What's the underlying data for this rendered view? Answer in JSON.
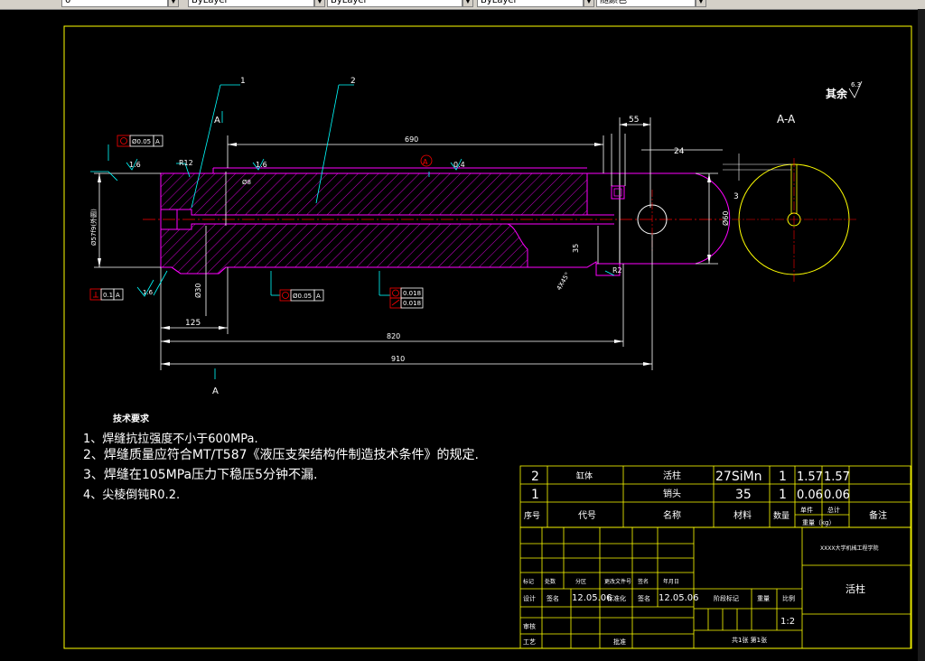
{
  "toolbar": {
    "layer_value": "0",
    "color_value": "ByLayer",
    "linetype_value": "ByLayer",
    "lineweight_value": "ByLayer",
    "plotstyle_value": "随颜色"
  },
  "drawing": {
    "section_title": "A-A",
    "roughness_other": "其余",
    "roughness_other_value": "6.3",
    "part_labels": [
      "1",
      "2"
    ],
    "section_marks": [
      "A",
      "A"
    ],
    "dims": {
      "d690": "690",
      "d55": "55",
      "d24": "24",
      "d125": "125",
      "d910": "910",
      "d_inner": "820",
      "d35": "35",
      "d30": "Ø30",
      "d3": "3",
      "d60": "Ø60",
      "r12": "R12",
      "r2": "R2",
      "d45": "4X45°",
      "phi57": "Ø57f9(外圆)",
      "phi8": "Ø8"
    },
    "roughness": [
      "1.6",
      "1.6",
      "0.4",
      "1.6"
    ],
    "tolerances": {
      "coax1_value": "Ø0.05",
      "coax1_datum": "A",
      "coax2_value": "Ø0.05",
      "coax2_datum": "A",
      "perp_value": "0.1",
      "perp_datum": "A",
      "round_value": "0.018",
      "cyl_value": "0.018",
      "datum_a": "A"
    }
  },
  "tech": {
    "heading": "技术要求",
    "items": [
      "1、焊缝抗拉强度不小于600MPa.",
      "2、焊缝质量应符合MT/T587《液压支架结构件制造技术条件》的规定.",
      "3、焊缝在105MPa压力下稳压5分钟不漏.",
      "4、尖棱倒钝R0.2."
    ]
  },
  "bom": {
    "rows": [
      {
        "no": "2",
        "code": "缸体",
        "name": "活柱",
        "material": "27SiMn",
        "qty": "1",
        "unit_w": "1.57",
        "total_w": "1.57",
        "note": ""
      },
      {
        "no": "1",
        "code": "",
        "name": "销头",
        "material": "35",
        "qty": "1",
        "unit_w": "0.06",
        "total_w": "0.06",
        "note": ""
      }
    ],
    "header": {
      "no": "序号",
      "code": "代号",
      "name": "名称",
      "material": "材料",
      "qty": "数量",
      "unit_w": "单件",
      "total_w": "总计",
      "weight": "重量（kg）",
      "note": "备注"
    }
  },
  "title_block": {
    "labels_row1": [
      "标记",
      "处数",
      "分区",
      "更改文件号",
      "签名",
      "年月日"
    ],
    "designer_label": "设计",
    "designer": "签名",
    "designer_date": "12.05.06",
    "std_label": "标准化",
    "std_name": "签名",
    "std_date": "12.05.06",
    "stage_label": "阶段标记",
    "weight_label": "重量",
    "scale_label": "比例",
    "scale": "1:2",
    "check_label": "审核",
    "process_label": "工艺",
    "approve_label": "批准",
    "sheets": "共1张 第1张",
    "org": "XXXX大学机械工程学院",
    "drawing_name": "活柱"
  }
}
